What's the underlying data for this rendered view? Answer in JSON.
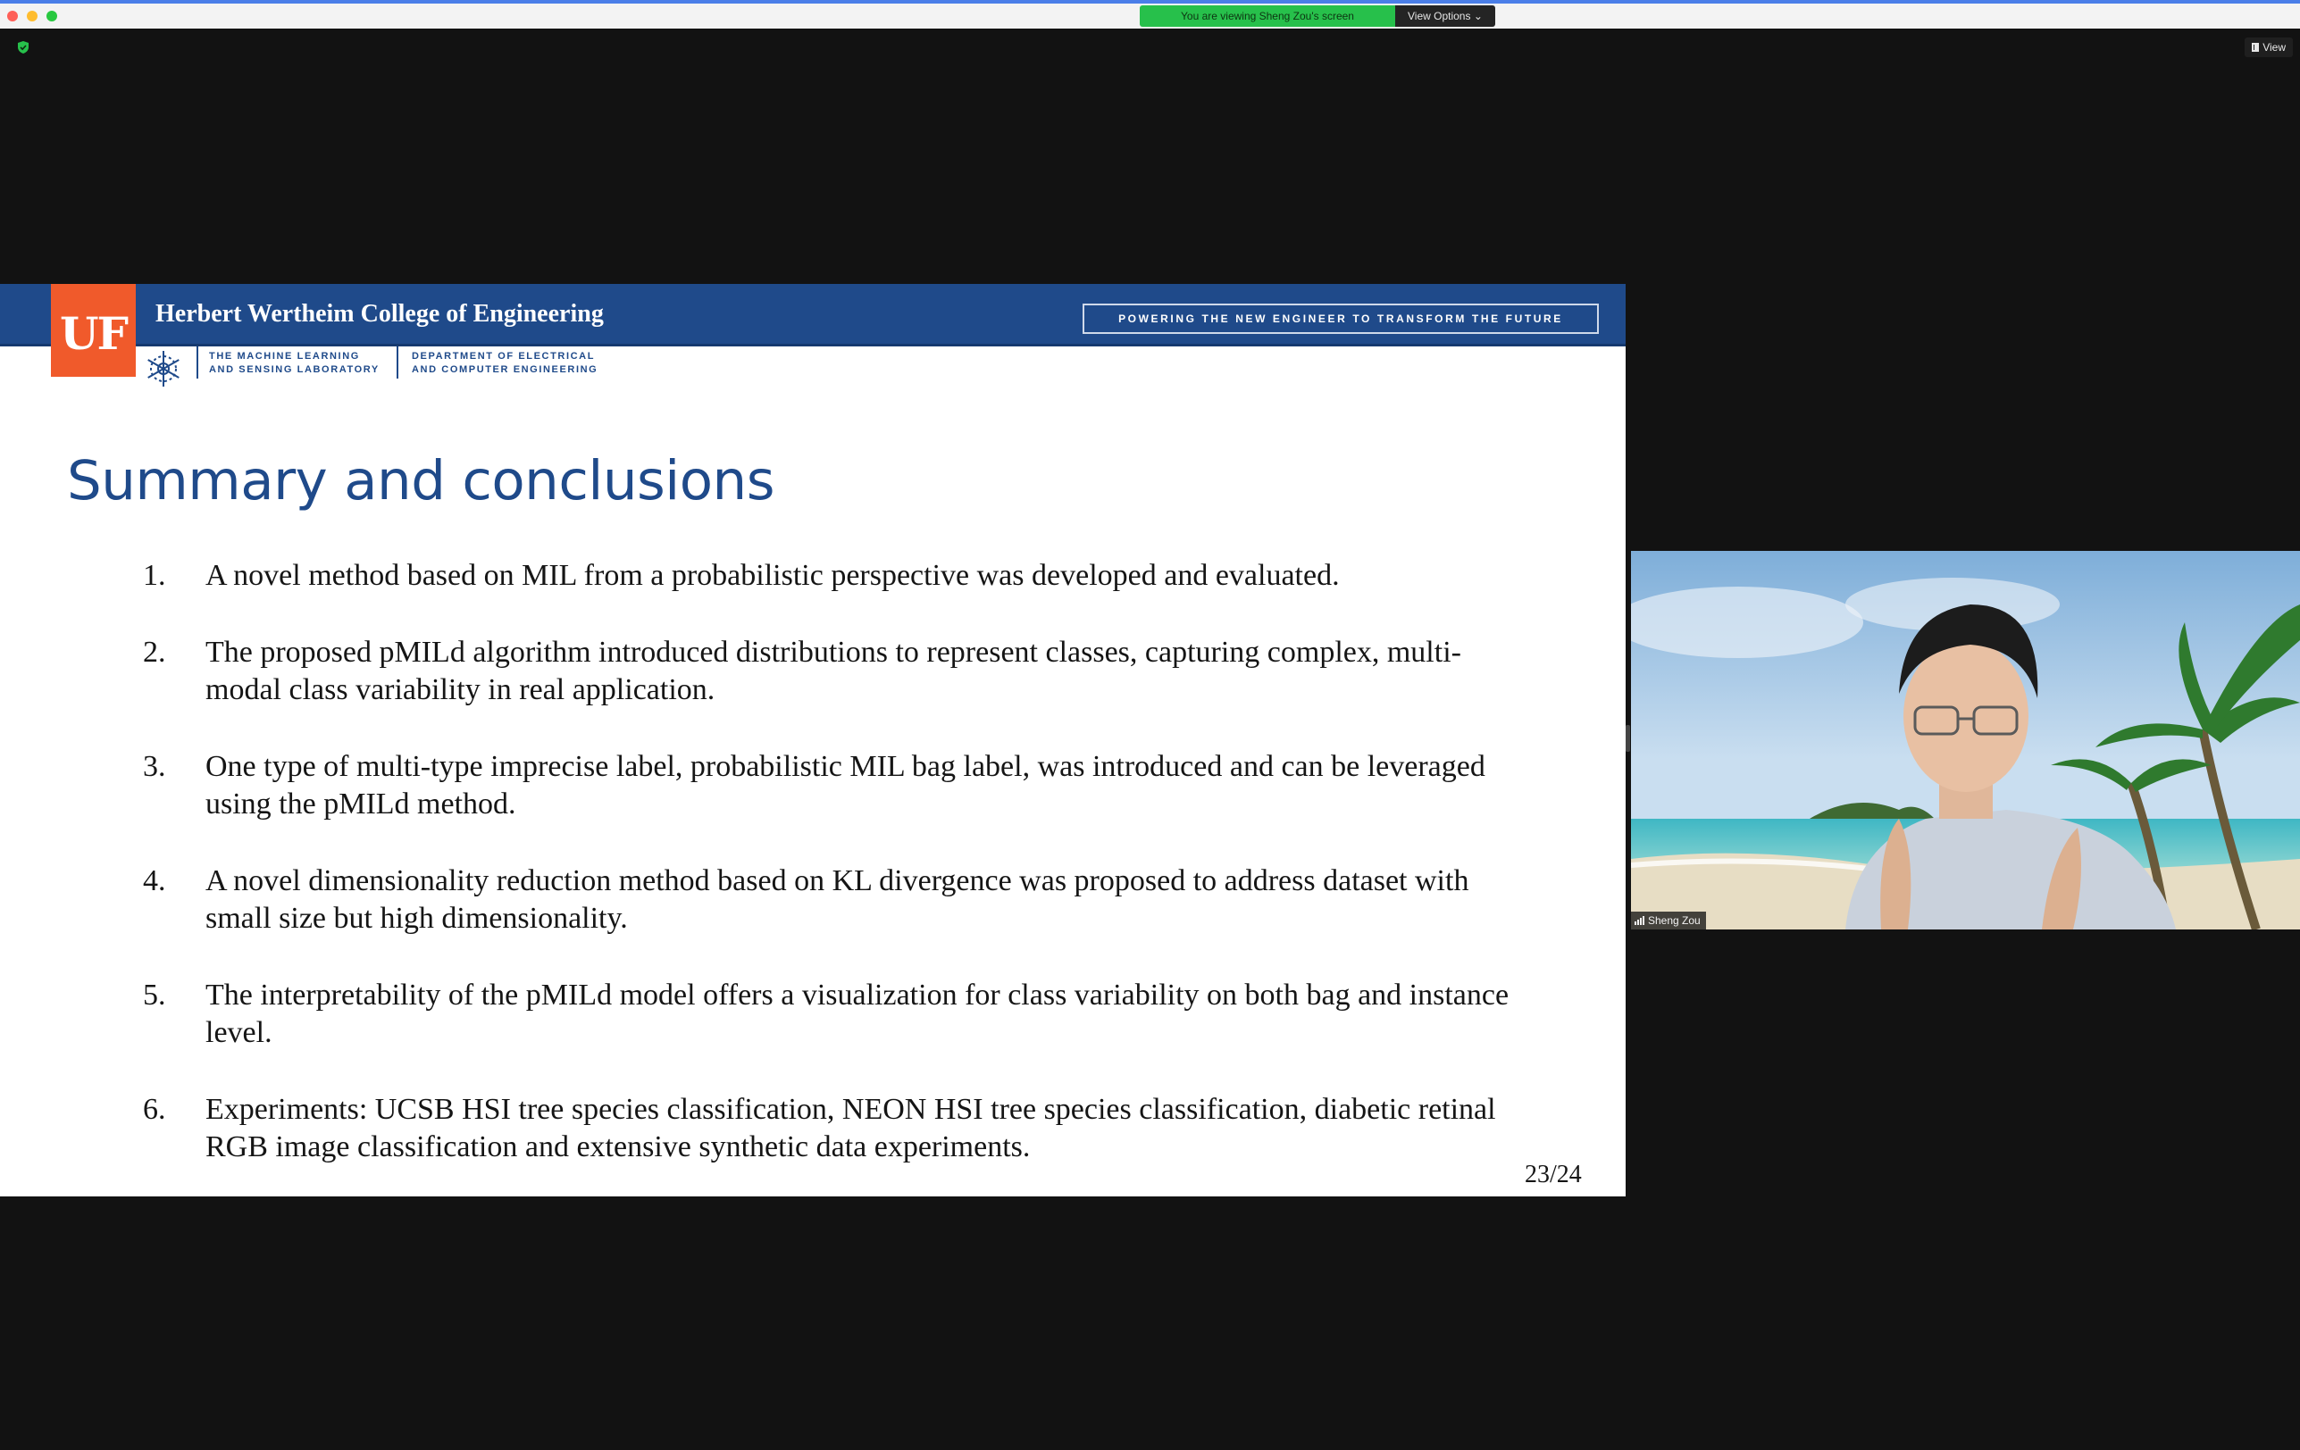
{
  "window": {
    "share_banner_text": "You are viewing Sheng Zou's screen",
    "view_options_label": "View Options ⌄",
    "view_button_label": "View"
  },
  "slide": {
    "logo_text": "UF",
    "college_name": "Herbert Wertheim College of Engineering",
    "tagline": "POWERING THE NEW ENGINEER TO TRANSFORM THE FUTURE",
    "lab_line1": "THE MACHINE LEARNING",
    "lab_line2": "AND SENSING LABORATORY",
    "dept_line1": "DEPARTMENT OF ELECTRICAL",
    "dept_line2": "AND COMPUTER ENGINEERING",
    "title": "Summary and conclusions",
    "items": [
      {
        "num": "1.",
        "text": "A novel method based on MIL from a probabilistic perspective was developed and evaluated."
      },
      {
        "num": "2.",
        "text": "The proposed pMILd algorithm introduced distributions to represent classes, capturing complex, multi-modal class variability in real application."
      },
      {
        "num": "3.",
        "text": "One type of multi-type imprecise label, probabilistic MIL bag label, was introduced and can be leveraged using the pMILd method."
      },
      {
        "num": "4.",
        "text": "A novel dimensionality reduction method based on KL divergence was proposed to address dataset with small size but high dimensionality."
      },
      {
        "num": "5.",
        "text": " The interpretability of the pMILd model offers a visualization for class variability on both bag and instance level."
      },
      {
        "num": "6.",
        "text": "Experiments: UCSB HSI tree species classification, NEON HSI tree species classification, diabetic retinal RGB image classification and extensive synthetic data experiments."
      }
    ],
    "page_number": "23/24"
  },
  "video": {
    "participant_name": "Sheng Zou"
  },
  "colors": {
    "slide_blue": "#1f4a8a",
    "uf_orange": "#f05a2b",
    "share_green": "#27c04b"
  }
}
